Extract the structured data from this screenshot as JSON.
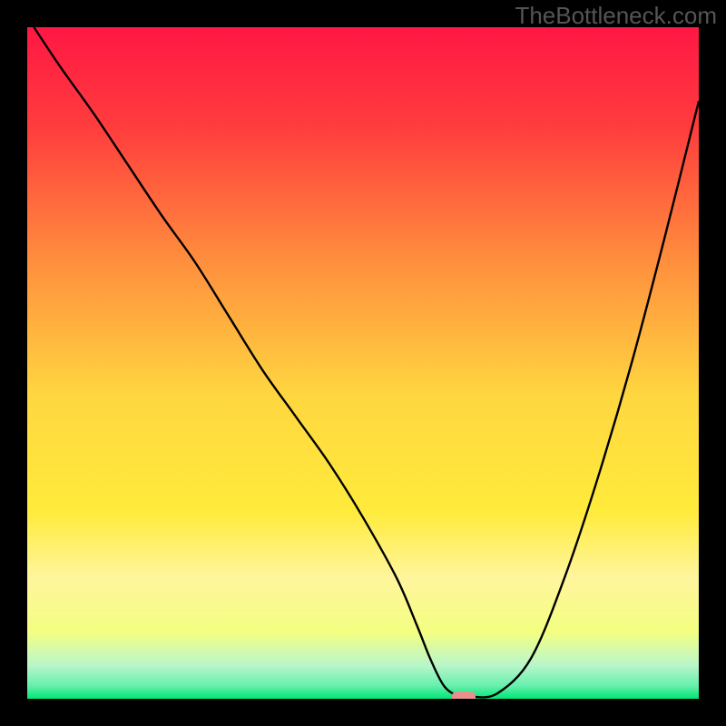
{
  "watermark": "TheBottleneck.com",
  "chart_data": {
    "type": "line",
    "title": "",
    "xlabel": "",
    "ylabel": "",
    "xlim": [
      0,
      100
    ],
    "ylim": [
      0,
      100
    ],
    "background": {
      "type": "vertical_gradient",
      "stops": [
        {
          "offset": 0,
          "color": "#ff1744"
        },
        {
          "offset": 15,
          "color": "#ff3d3d"
        },
        {
          "offset": 35,
          "color": "#ff8f3d"
        },
        {
          "offset": 55,
          "color": "#ffd740"
        },
        {
          "offset": 72,
          "color": "#ffeb3b"
        },
        {
          "offset": 82,
          "color": "#fff59d"
        },
        {
          "offset": 90,
          "color": "#f4ff81"
        },
        {
          "offset": 95,
          "color": "#b9f6ca"
        },
        {
          "offset": 98,
          "color": "#69f0ae"
        },
        {
          "offset": 100,
          "color": "#00e676"
        }
      ]
    },
    "series": [
      {
        "name": "bottleneck_curve",
        "type": "line",
        "color": "#000000",
        "width": 2.4,
        "x": [
          1,
          5,
          10,
          15,
          20,
          25,
          30,
          35,
          40,
          45,
          50,
          55,
          58,
          60,
          62,
          64,
          66,
          70,
          75,
          80,
          85,
          90,
          95,
          100
        ],
        "y": [
          100,
          94,
          87,
          79.5,
          72,
          65,
          57,
          49,
          42,
          35,
          27,
          18,
          11,
          6,
          2,
          0.5,
          0.3,
          0.8,
          6,
          18,
          33,
          50,
          69,
          89
        ]
      }
    ],
    "marker": {
      "name": "optimum_marker",
      "x": 65,
      "y": 0,
      "color": "#e9908f",
      "shape": "rounded_rect"
    }
  }
}
